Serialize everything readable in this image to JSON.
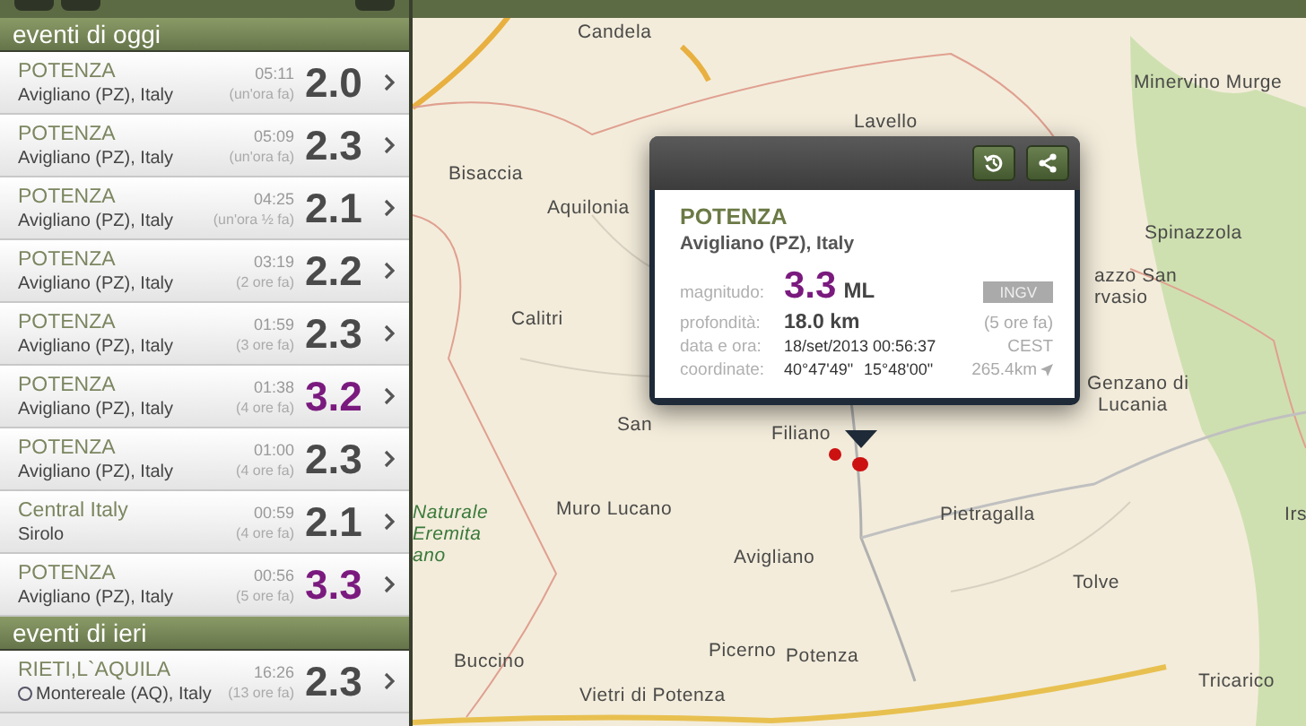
{
  "sections": [
    {
      "title": "eventi di oggi",
      "events": [
        {
          "place": "POTENZA",
          "region": "Avigliano (PZ), Italy",
          "time": "05:11",
          "ago": "(un'ora fa)",
          "magnitude": "2.0",
          "color": "#4a4a4a",
          "marker": false
        },
        {
          "place": "POTENZA",
          "region": "Avigliano (PZ), Italy",
          "time": "05:09",
          "ago": "(un'ora fa)",
          "magnitude": "2.3",
          "color": "#4a4a4a",
          "marker": false
        },
        {
          "place": "POTENZA",
          "region": "Avigliano (PZ), Italy",
          "time": "04:25",
          "ago": "(un'ora ½ fa)",
          "magnitude": "2.1",
          "color": "#4a4a4a",
          "marker": false
        },
        {
          "place": "POTENZA",
          "region": "Avigliano (PZ), Italy",
          "time": "03:19",
          "ago": "(2 ore fa)",
          "magnitude": "2.2",
          "color": "#4a4a4a",
          "marker": false
        },
        {
          "place": "POTENZA",
          "region": "Avigliano (PZ), Italy",
          "time": "01:59",
          "ago": "(3 ore fa)",
          "magnitude": "2.3",
          "color": "#4a4a4a",
          "marker": false
        },
        {
          "place": "POTENZA",
          "region": "Avigliano (PZ), Italy",
          "time": "01:38",
          "ago": "(4 ore fa)",
          "magnitude": "3.2",
          "color": "#7a1a7e",
          "marker": false
        },
        {
          "place": "POTENZA",
          "region": "Avigliano (PZ), Italy",
          "time": "01:00",
          "ago": "(4 ore fa)",
          "magnitude": "2.3",
          "color": "#4a4a4a",
          "marker": false
        },
        {
          "place": "Central Italy",
          "region": "Sirolo",
          "time": "00:59",
          "ago": "(4 ore fa)",
          "magnitude": "2.1",
          "color": "#4a4a4a",
          "marker": false
        },
        {
          "place": "POTENZA",
          "region": "Avigliano (PZ), Italy",
          "time": "00:56",
          "ago": "(5 ore fa)",
          "magnitude": "3.3",
          "color": "#7a1a7e",
          "marker": false
        }
      ]
    },
    {
      "title": "eventi di ieri",
      "events": [
        {
          "place": "RIETI,L`AQUILA",
          "region": "Montereale (AQ), Italy",
          "time": "16:26",
          "ago": "(13 ore fa)",
          "magnitude": "2.3",
          "color": "#4a4a4a",
          "marker": true
        }
      ]
    }
  ],
  "map": {
    "places": [
      {
        "name": "Candela"
      },
      {
        "name": "Lavello"
      },
      {
        "name": "Minervino Murge"
      },
      {
        "name": "Bisaccia"
      },
      {
        "name": "Aquilonia"
      },
      {
        "name": "Spinazzola"
      },
      {
        "name": "azzo San"
      },
      {
        "name": "rvasio"
      },
      {
        "name": "Calitri"
      },
      {
        "name": "San"
      },
      {
        "name": "Filiano"
      },
      {
        "name": "Genzano di"
      },
      {
        "name": "Lucania"
      },
      {
        "name": "Naturale"
      },
      {
        "name": "Eremita"
      },
      {
        "name": "ano"
      },
      {
        "name": "Muro Lucano"
      },
      {
        "name": "Pietragalla"
      },
      {
        "name": "Avigliano"
      },
      {
        "name": "Tolve"
      },
      {
        "name": "Irs"
      },
      {
        "name": "Buccino"
      },
      {
        "name": "Picerno"
      },
      {
        "name": "Potenza"
      },
      {
        "name": "Tricarico"
      },
      {
        "name": "Vietri di Potenza"
      }
    ]
  },
  "popup": {
    "place": "POTENZA",
    "region": "Avigliano (PZ), Italy",
    "magnitude": {
      "label": "magnitudo:",
      "value": "3.3",
      "unit": "ML",
      "source": "INGV"
    },
    "depth": {
      "label": "profondità:",
      "value": "18.0 km",
      "ago": "(5 ore fa)"
    },
    "datetime": {
      "label": "data e ora:",
      "value": "18/set/2013 00:56:37",
      "zone": "CEST"
    },
    "coordinates": {
      "label": "coordinate:",
      "lat": "40°47'49\"",
      "lon": "15°48'00\"",
      "distance": "265.4km"
    }
  }
}
